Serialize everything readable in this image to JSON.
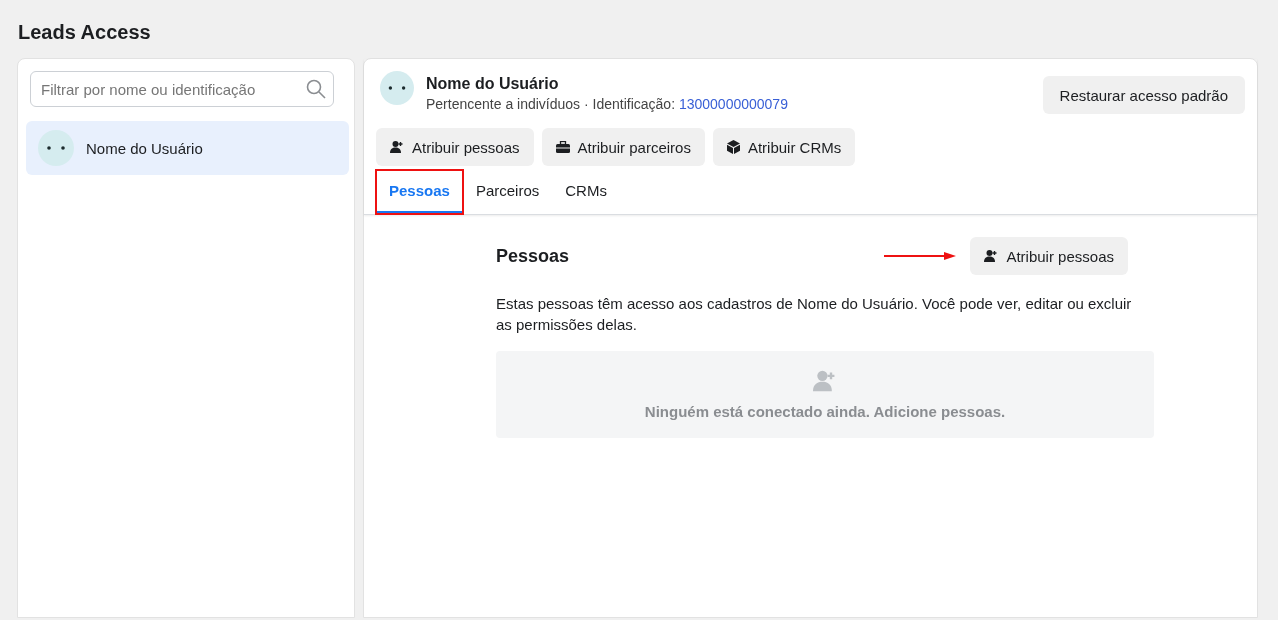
{
  "page_title": "Leads Access",
  "sidebar": {
    "search": {
      "placeholder": "Filtrar por nome ou identificação"
    },
    "items": [
      {
        "name": "Nome do Usuário",
        "selected": true
      }
    ]
  },
  "profile": {
    "name": "Nome do Usuário",
    "subtitle": "Pertencente a indivíduos · Identificação:",
    "id_link": "13000000000079",
    "restore_button": "Restaurar acesso padrão"
  },
  "actions": [
    {
      "kind": "people",
      "label": "Atribuir pessoas"
    },
    {
      "kind": "partners",
      "label": "Atribuir parceiros"
    },
    {
      "kind": "crm",
      "label": "Atribuir CRMs"
    }
  ],
  "tabs": [
    {
      "label": "Pessoas",
      "selected": true,
      "highlighted": true
    },
    {
      "label": "Parceiros",
      "selected": false,
      "highlighted": false
    },
    {
      "label": "CRMs",
      "selected": false,
      "highlighted": false
    }
  ],
  "section": {
    "title": "Pessoas",
    "button": "Atribuir pessoas",
    "description": "Estas pessoas têm acesso aos cadastros de Nome do Usuário. Você pode ver, editar ou excluir as permissões delas.",
    "empty_message": "Ninguém está conectado ainda. Adicione pessoas."
  }
}
